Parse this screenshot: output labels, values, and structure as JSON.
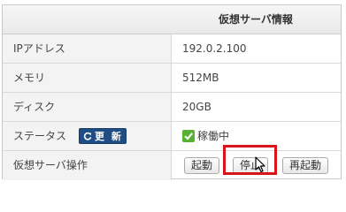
{
  "header": {
    "title": "仮想サーバ情報"
  },
  "rows": [
    {
      "label": "IPアドレス",
      "value": "192.0.2.100"
    },
    {
      "label": "メモリ",
      "value": "512MB"
    },
    {
      "label": "ディスク",
      "value": "20GB"
    },
    {
      "label": "ステータス",
      "update_button": "更 新",
      "value": "稼働中",
      "status_icon": "check-icon",
      "status_color": "#57b234"
    },
    {
      "label": "仮想サーバ操作"
    }
  ],
  "operations": {
    "start": "起動",
    "stop": "停止",
    "restart": "再起動"
  },
  "colors": {
    "update_button_bg": "#1f4e84",
    "highlight": "#d9141b"
  }
}
